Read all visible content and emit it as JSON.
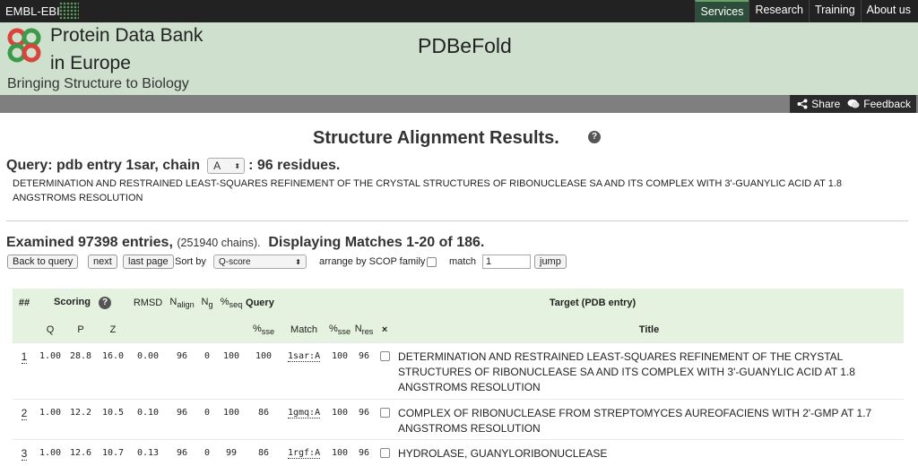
{
  "topbar": {
    "brand": "EMBL-EBI",
    "nav": [
      "Services",
      "Research",
      "Training",
      "About us"
    ]
  },
  "header": {
    "title_line1": "Protein Data Bank",
    "title_line2": "in Europe",
    "tagline": "Bringing Structure to Biology",
    "app_name": "PDBeFold"
  },
  "actions": {
    "share": "Share",
    "feedback": "Feedback"
  },
  "results": {
    "title": "Structure Alignment Results.",
    "query_prefix": "Query: pdb entry 1sar, chain",
    "chain": "A",
    "query_suffix": ": 96 residues.",
    "description": "DETERMINATION AND RESTRAINED LEAST-SQUARES REFINEMENT OF THE CRYSTAL STRUCTURES OF RIBONUCLEASE SA AND ITS COMPLEX WITH 3'-GUANYLIC ACID AT 1.8 ANGSTROMS RESOLUTION",
    "examined_main": "Examined 97398 entries,",
    "examined_chains": "(251940 chains).",
    "displaying": "Displaying Matches 1-20 of 186."
  },
  "controls": {
    "back_to_query": "Back to query",
    "next": "next",
    "last_page": "last page",
    "sort_by_label": "Sort by",
    "sort_value": "Q-score",
    "arrange_label": "arrange by SCOP family",
    "match_label": "match",
    "match_value": "1",
    "jump": "jump"
  },
  "table": {
    "h_hash": "##",
    "h_scoring": "Scoring",
    "h_rmsd": "RMSD",
    "h_nalign": "N",
    "h_nalign_sub": "align",
    "h_ng": "N",
    "h_ng_sub": "g",
    "h_pseq": "%",
    "h_pseq_sub": "seq",
    "h_query": "Query",
    "h_target": "Target (PDB entry)",
    "h_q": "Q",
    "h_p": "P",
    "h_z": "Z",
    "h_psse_q": "%",
    "h_psse_q_sub": "sse",
    "h_match": "Match",
    "h_psse_t": "%",
    "h_psse_t_sub": "sse",
    "h_nres": "N",
    "h_nres_sub": "res",
    "h_x": "×",
    "h_title": "Title",
    "rows": [
      {
        "n": "1",
        "q": "1.00",
        "p": "28.8",
        "z": "16.0",
        "rmsd": "0.00",
        "nalign": "96",
        "ng": "0",
        "pseq": "100",
        "psse_q": "100",
        "match": "1sar:A",
        "psse_t": "100",
        "nres": "96",
        "title": "DETERMINATION AND RESTRAINED LEAST-SQUARES REFINEMENT OF THE CRYSTAL STRUCTURES OF RIBONUCLEASE SA AND ITS COMPLEX WITH 3'-GUANYLIC ACID AT 1.8 ANGSTROMS RESOLUTION"
      },
      {
        "n": "2",
        "q": "1.00",
        "p": "12.2",
        "z": "10.5",
        "rmsd": "0.10",
        "nalign": "96",
        "ng": "0",
        "pseq": "100",
        "psse_q": "86",
        "match": "1gmq:A",
        "psse_t": "100",
        "nres": "96",
        "title": "COMPLEX OF RIBONUCLEASE FROM STREPTOMYCES AUREOFACIENS WITH 2'-GMP AT 1.7 ANGSTROMS RESOLUTION"
      },
      {
        "n": "3",
        "q": "1.00",
        "p": "12.6",
        "z": "10.7",
        "rmsd": "0.13",
        "nalign": "96",
        "ng": "0",
        "pseq": "99",
        "psse_q": "86",
        "match": "1rgf:A",
        "psse_t": "100",
        "nres": "96",
        "title": "HYDROLASE, GUANYLORIBONUCLEASE"
      }
    ]
  },
  "colors": {
    "header_bg": "#cfe0cf",
    "table_header_bg": "#e6f2e0",
    "topbar_bg": "#222222"
  }
}
